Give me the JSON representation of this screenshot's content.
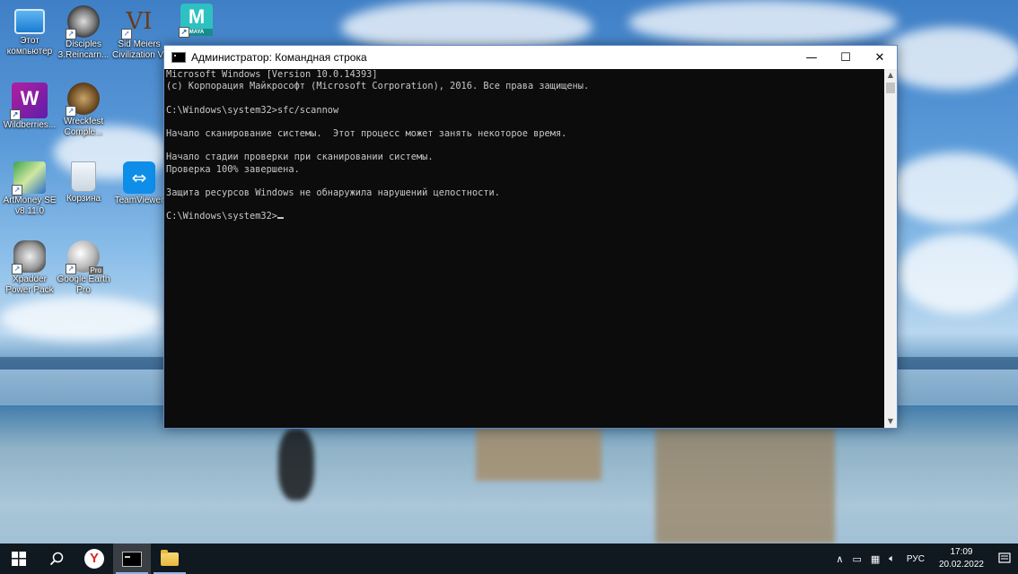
{
  "desktop": {
    "icons": [
      {
        "label": "Этот компьютер",
        "icon": "this-pc-icon"
      },
      {
        "label": "Disciples 3.Reincarn...",
        "icon": "disciples-game-icon"
      },
      {
        "label": "Sid Meiers Civilization VI",
        "icon": "civilization-game-icon"
      },
      {
        "label": "",
        "icon": "autodesk-maya-icon",
        "badge": "MAYA"
      },
      {
        "label": "Wildberries...",
        "icon": "wildberries-icon",
        "badge": "W"
      },
      {
        "label": "Wreckfest Comple...",
        "icon": "wreckfest-game-icon"
      },
      {
        "label": "ArtMoney SE v8.11.0",
        "icon": "artmoney-icon"
      },
      {
        "label": "Корзина",
        "icon": "recycle-bin-icon"
      },
      {
        "label": "TeamViewer",
        "icon": "teamviewer-icon"
      },
      {
        "label": "Xpadder Power Pack",
        "icon": "xpadder-gamepad-icon"
      },
      {
        "label": "Google Earth Pro",
        "icon": "google-earth-pro-icon",
        "badge": "Pro"
      }
    ]
  },
  "window": {
    "title": "Администратор: Командная строка",
    "minimize": "—",
    "maximize": "☐",
    "close": "✕",
    "console_lines": [
      "Microsoft Windows [Version 10.0.14393]",
      "(c) Корпорация Майкрософт (Microsoft Corporation), 2016. Все права защищены.",
      "",
      "C:\\Windows\\system32>sfc/scannow",
      "",
      "Начало сканирование системы.  Этот процесс может занять некоторое время.",
      "",
      "Начало стадии проверки при сканировании системы.",
      "Проверка 100% завершена.",
      "",
      "Защита ресурсов Windows не обнаружила нарушений целостности.",
      "",
      "C:\\Windows\\system32>"
    ]
  },
  "taskbar": {
    "apps": [
      {
        "name": "start-button",
        "icon": "windows-logo-icon"
      },
      {
        "name": "search-button",
        "icon": "search-icon"
      },
      {
        "name": "yandex-browser",
        "icon": "yandex-icon"
      },
      {
        "name": "command-prompt",
        "icon": "cmd-icon",
        "active": true
      },
      {
        "name": "file-explorer",
        "icon": "folder-icon"
      }
    ],
    "tray": {
      "language": "РУС",
      "time": "17:09",
      "date": "20.02.2022"
    }
  },
  "colors": {
    "console_bg": "#0c0c0c",
    "console_text": "#c8c8c8",
    "taskbar_bg": "#101820",
    "title_bar": "#ffffff"
  }
}
